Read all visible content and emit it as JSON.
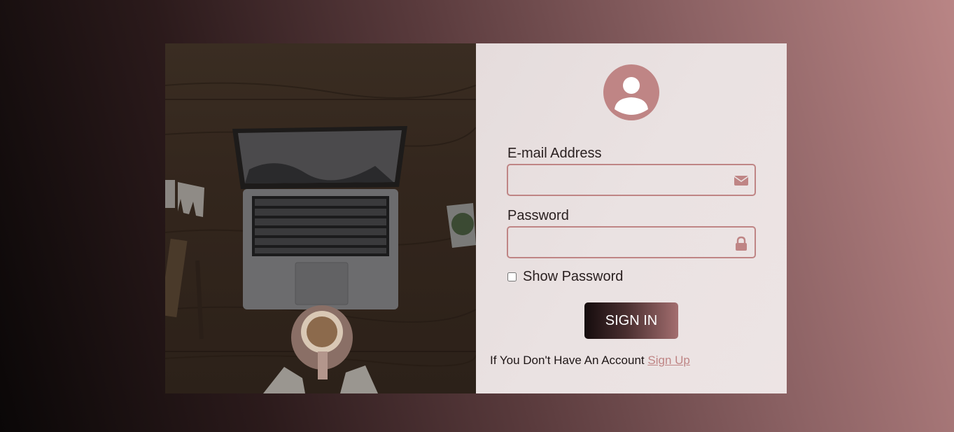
{
  "photo": {
    "description_icon": "laptop-coffee-photo"
  },
  "form": {
    "avatar_icon": "user-avatar-icon",
    "email_label": "E-mail Address",
    "email_value": "",
    "email_icon": "envelope-icon",
    "password_label": "Password",
    "password_value": "",
    "password_icon": "lock-icon",
    "show_password_label": "Show Password",
    "show_password_checked": false,
    "signin_label": "SIGN IN",
    "signup_prompt": "If You Don't Have An Account",
    "signup_link": "Sign Up"
  },
  "colors": {
    "accent": "#bf8585",
    "panel_bg": "#e9e1e1"
  }
}
